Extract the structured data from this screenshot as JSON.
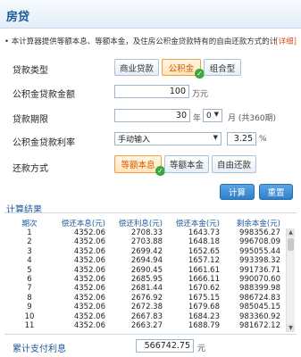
{
  "header": {
    "title": "房贷"
  },
  "intro": {
    "text": "• 本计算器提供等额本息、等额本金，及住房公积金贷款特有的自由还款方式的计",
    "detail_link": "[详细]"
  },
  "loan_type": {
    "label": "贷款类型",
    "options": [
      "商业贷款",
      "公积金",
      "组合型"
    ],
    "selected_index": 1
  },
  "fund_amount": {
    "label": "公积金贷款金额",
    "value": "100",
    "unit": "万元"
  },
  "loan_term": {
    "label": "贷款期限",
    "years": "30",
    "years_unit": "年",
    "months": "0",
    "months_note": "月 (共360期)"
  },
  "fund_rate": {
    "label": "公积金贷款利率",
    "mode": "手动输入",
    "value": "3.25",
    "unit": "%"
  },
  "repay_method": {
    "label": "还款方式",
    "options": [
      "等额本息",
      "等额本金",
      "自由还款"
    ],
    "selected_index": 0
  },
  "buttons": {
    "calculate": "计算",
    "reset": "重置"
  },
  "results": {
    "title": "计算结果",
    "columns": [
      "期次",
      "偿还本息(元)",
      "偿还利息(元)",
      "偿还本金(元)",
      "剩余本金(元)"
    ],
    "rows": [
      [
        "1",
        "4352.06",
        "2708.33",
        "1643.73",
        "998356.27"
      ],
      [
        "2",
        "4352.06",
        "2703.88",
        "1648.18",
        "996708.09"
      ],
      [
        "3",
        "4352.06",
        "2699.42",
        "1652.65",
        "995055.44"
      ],
      [
        "4",
        "4352.06",
        "2694.94",
        "1657.12",
        "993398.32"
      ],
      [
        "5",
        "4352.06",
        "2690.45",
        "1661.61",
        "991736.71"
      ],
      [
        "6",
        "4352.06",
        "2685.95",
        "1666.11",
        "990070.60"
      ],
      [
        "7",
        "4352.06",
        "2681.44",
        "1670.62",
        "988399.98"
      ],
      [
        "8",
        "4352.06",
        "2676.92",
        "1675.15",
        "986724.83"
      ],
      [
        "9",
        "4352.06",
        "2672.38",
        "1679.68",
        "985045.15"
      ],
      [
        "10",
        "4352.06",
        "2667.83",
        "1684.23",
        "983360.92"
      ],
      [
        "11",
        "4352.06",
        "2663.27",
        "1688.79",
        "981672.12"
      ]
    ]
  },
  "total_interest": {
    "label": "累计支付利息",
    "value": "566742.75",
    "unit": "元"
  }
}
